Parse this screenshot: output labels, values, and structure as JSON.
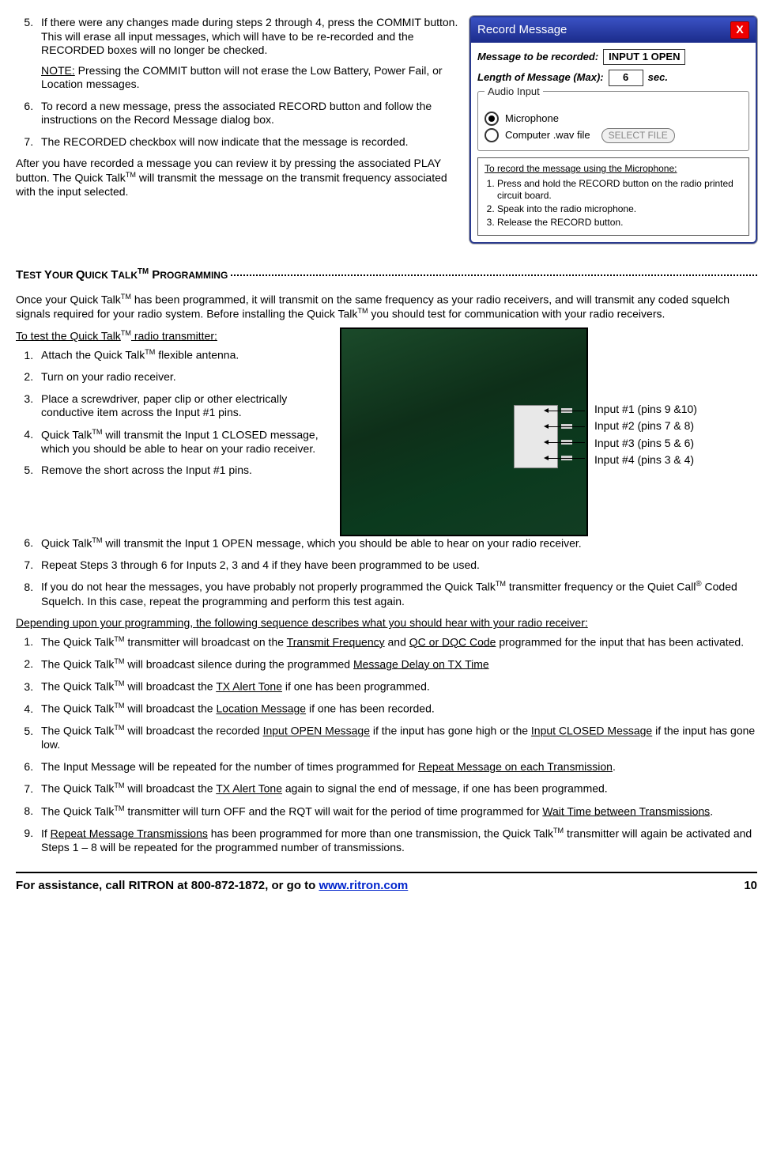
{
  "top_steps": {
    "s5": "If there were any changes made during steps 2 through 4, press the COMMIT button.  This will erase all input messages, which will have to be re-recorded and the RECORDED boxes will no longer be checked.",
    "s5_note_label": "NOTE:",
    "s5_note": " Pressing the COMMIT button will not erase the Low Battery, Power Fail, or Location messages.",
    "s6": "To record a new message, press the associated RECORD button and follow the instructions on the Record Message dialog box.",
    "s7": "The RECORDED checkbox will now indicate that the message is recorded.",
    "after": "After you have recorded a message you can review it by pressing the associated PLAY button.  The Quick Talk",
    "after2": " will transmit the message on the transmit frequency associated with the input selected."
  },
  "dialog": {
    "title": "Record Message",
    "row1_label": "Message to be recorded:",
    "row1_val": "INPUT 1 OPEN",
    "row2_label": "Length of Message (Max):",
    "row2_val": "6",
    "row2_unit": "sec.",
    "audio_legend": "Audio Input",
    "radio_mic": "Microphone",
    "radio_wav": "Computer .wav file",
    "select_file": "SELECT FILE",
    "instr_title": "To record the message using the Microphone:",
    "instr1": "Press and hold the RECORD button on the radio printed circuit board.",
    "instr2": "Speak into the radio microphone.",
    "instr3": "Release the RECORD button."
  },
  "section_heading_a": "T",
  "section_heading_b": "EST ",
  "section_heading_c": "Y",
  "section_heading_d": "OUR ",
  "section_heading_e": "Q",
  "section_heading_f": "UICK ",
  "section_heading_g": "T",
  "section_heading_h": "ALK",
  "section_heading_i": " P",
  "section_heading_j": "ROGRAMMING",
  "tm": "TM",
  "intro1": "Once your Quick Talk",
  "intro2": " has been programmed, it will transmit on the same frequency as your radio receivers, and will transmit any coded squelch signals required for your radio system.   Before installing the Quick Talk",
  "intro3": " you should test for communication with your radio receivers.",
  "test_heading": "To test the Quick Talk",
  "test_heading2": " radio transmitter:",
  "test": {
    "s1a": "Attach the Quick Talk",
    "s1b": " flexible antenna.",
    "s2": "Turn on your radio receiver.",
    "s3": "Place a screwdriver, paper clip or other electrically conductive item across the Input #1 pins.",
    "s4a": "Quick Talk",
    "s4b": " will transmit the Input 1 CLOSED message, which you should be able to hear on your radio receiver.",
    "s5": "Remove the short across the Input #1 pins.",
    "s6a": "Quick Talk",
    "s6b": " will transmit the Input 1 OPEN message, which you should be able to hear on your radio receiver.",
    "s7": "Repeat Steps 3 through 6 for Inputs 2, 3 and 4 if they have been programmed to be used.",
    "s8a": "If you do not hear the messages, you have probably not properly programmed the Quick Talk",
    "s8b": " transmitter frequency or the Quiet Call",
    "s8c": " Coded Squelch.  In this case, repeat the programming and perform this test again."
  },
  "pins": {
    "p1": "Input #1 (pins 9 &10)",
    "p2": "Input #2 (pins 7 & 8)",
    "p3": "Input #3 (pins 5 & 6)",
    "p4": "Input #4 (pins 3 & 4)"
  },
  "seq_heading": "Depending upon your programming, the following sequence describes what you should hear with your radio receiver:",
  "seq": {
    "s1a": "The Quick Talk",
    "s1b": " transmitter will broadcast on the ",
    "s1c": "Transmit Frequency",
    "s1d": " and ",
    "s1e": "QC or DQC Code",
    "s1f": " programmed for the input that has been activated.",
    "s2a": "The Quick Talk",
    "s2b": " will broadcast silence during the programmed ",
    "s2c": "Message Delay on TX Time",
    "s3a": "The Quick Talk",
    "s3b": " will broadcast the ",
    "s3c": "TX Alert Tone",
    "s3d": " if one has been programmed.",
    "s4a": "The Quick Talk",
    "s4b": " will broadcast the ",
    "s4c": "Location Message",
    "s4d": " if one has been recorded.",
    "s5a": "The Quick Talk",
    "s5b": " will broadcast the recorded ",
    "s5c": "Input OPEN Message",
    "s5d": " if the input has gone high or the ",
    "s5e": "Input CLOSED Message",
    "s5f": " if the input has gone low.",
    "s6a": "The Input Message will be repeated for the number of times programmed for ",
    "s6b": "Repeat Message on each Transmission",
    "s6c": ".",
    "s7a": "The Quick Talk",
    "s7b": " will broadcast the ",
    "s7c": "TX Alert Tone",
    "s7d": " again to signal the end of message, if one has been programmed.",
    "s8a": "The Quick Talk",
    "s8b": " transmitter will turn OFF and the RQT will wait for the period of time programmed for ",
    "s8c": "Wait Time between Transmissions",
    "s8d": ".",
    "s9a": "If ",
    "s9b": "Repeat Message Transmissions",
    "s9c": " has been programmed for more than one transmission, the Quick Talk",
    "s9d": " transmitter will again be activated and Steps 1 – 8 will be repeated for the programmed number of transmissions."
  },
  "reg": "®",
  "footer": {
    "text": "For assistance, call RITRON at 800-872-1872, or go to ",
    "link": "www.ritron.com",
    "page": "10"
  }
}
